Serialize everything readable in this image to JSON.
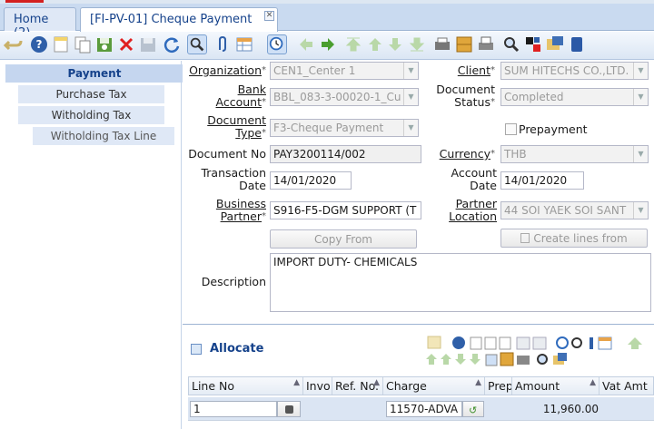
{
  "tabs": [
    {
      "label": "Home (2)"
    },
    {
      "label": "[FI-PV-01] Cheque Payment",
      "active": true
    }
  ],
  "toolbar": {
    "buttons": [
      "undo-icon",
      "help-icon",
      "new-icon",
      "copy-icon",
      "save-new-icon",
      "delete-icon",
      "save-icon",
      "refresh-icon",
      "find-icon",
      "attachment-icon",
      "grid-toggle-icon",
      "history-icon",
      "prev-record-icon",
      "next-record-icon",
      "first-record-icon",
      "parent-record-icon",
      "detail-record-icon",
      "last-record-icon",
      "report-icon",
      "archive-icon",
      "print-icon",
      "zoom-icon",
      "request-icon",
      "workflow-icon",
      "product-info-icon"
    ]
  },
  "nav": {
    "items": [
      "Payment",
      "Purchase Tax",
      "Witholding Tax",
      "Witholding Tax Line"
    ]
  },
  "form": {
    "organization": {
      "label": "Organization",
      "value": "CEN1_Center 1"
    },
    "client": {
      "label": "Client",
      "value": "SUM HITECHS CO.,LTD."
    },
    "bank_account": {
      "label1": "Bank",
      "label2": "Account",
      "value": "BBL_083-3-00020-1_Cu"
    },
    "document_status": {
      "label1": "Document",
      "label2": "Status",
      "value": "Completed"
    },
    "document_type": {
      "label1": "Document",
      "label2": "Type",
      "value": "F3-Cheque Payment"
    },
    "prepayment": {
      "label": "Prepayment",
      "checked": false
    },
    "document_no": {
      "label": "Document No",
      "value": "PAY3200114/002"
    },
    "currency": {
      "label": "Currency",
      "value": "THB"
    },
    "transaction_date": {
      "label1": "Transaction",
      "label2": "Date",
      "value": "14/01/2020"
    },
    "account_date": {
      "label1": "Account",
      "label2": "Date",
      "value": "14/01/2020"
    },
    "business_partner": {
      "label1": "Business",
      "label2": "Partner",
      "value": "S916-F5-DGM SUPPORT (T"
    },
    "partner_location": {
      "label1": "Partner",
      "label2": "Location",
      "value": "44 SOI YAEK SOI SANT"
    },
    "copy_from": "Copy From",
    "create_lines_from": "Create lines from",
    "description": {
      "label": "Description",
      "value": "IMPORT DUTY- CHEMICALS"
    }
  },
  "allocate": {
    "title": "Allocate",
    "columns": [
      "Line No",
      "Invo",
      "Ref. No.",
      "Charge",
      "Prep",
      "Amount",
      "Vat Amt"
    ],
    "rows": [
      {
        "line_no": "1",
        "charge": "11570-ADVA",
        "amount": "11,960.00"
      }
    ]
  }
}
